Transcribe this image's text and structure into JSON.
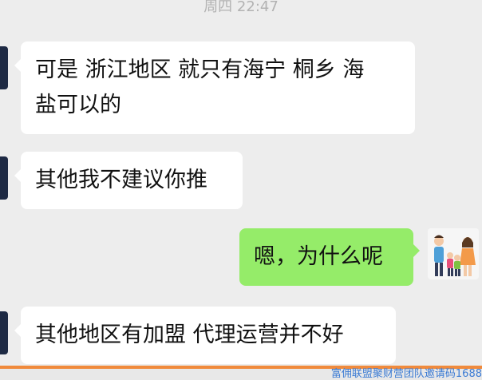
{
  "timestamp": "周四 22:47",
  "messages": [
    {
      "side": "left",
      "text": "可是 浙江地区 就只有海宁 桐乡 海\n盐可以的"
    },
    {
      "side": "left",
      "text": "其他我不建议你推"
    },
    {
      "side": "right",
      "text": "嗯，为什么呢"
    },
    {
      "side": "left",
      "text": "其他地区有加盟 代理运营并不好"
    }
  ],
  "watermark": "富佣联盟聚财营团队邀请码1688",
  "colors": {
    "background": "#ededed",
    "left_bubble": "#ffffff",
    "right_bubble": "#95ec69",
    "accent_bar": "#f08a3c",
    "watermark_text": "#3b7bd4"
  },
  "icons": {
    "left_avatar": "contact-avatar-icon",
    "right_avatar": "family-avatar-icon"
  }
}
